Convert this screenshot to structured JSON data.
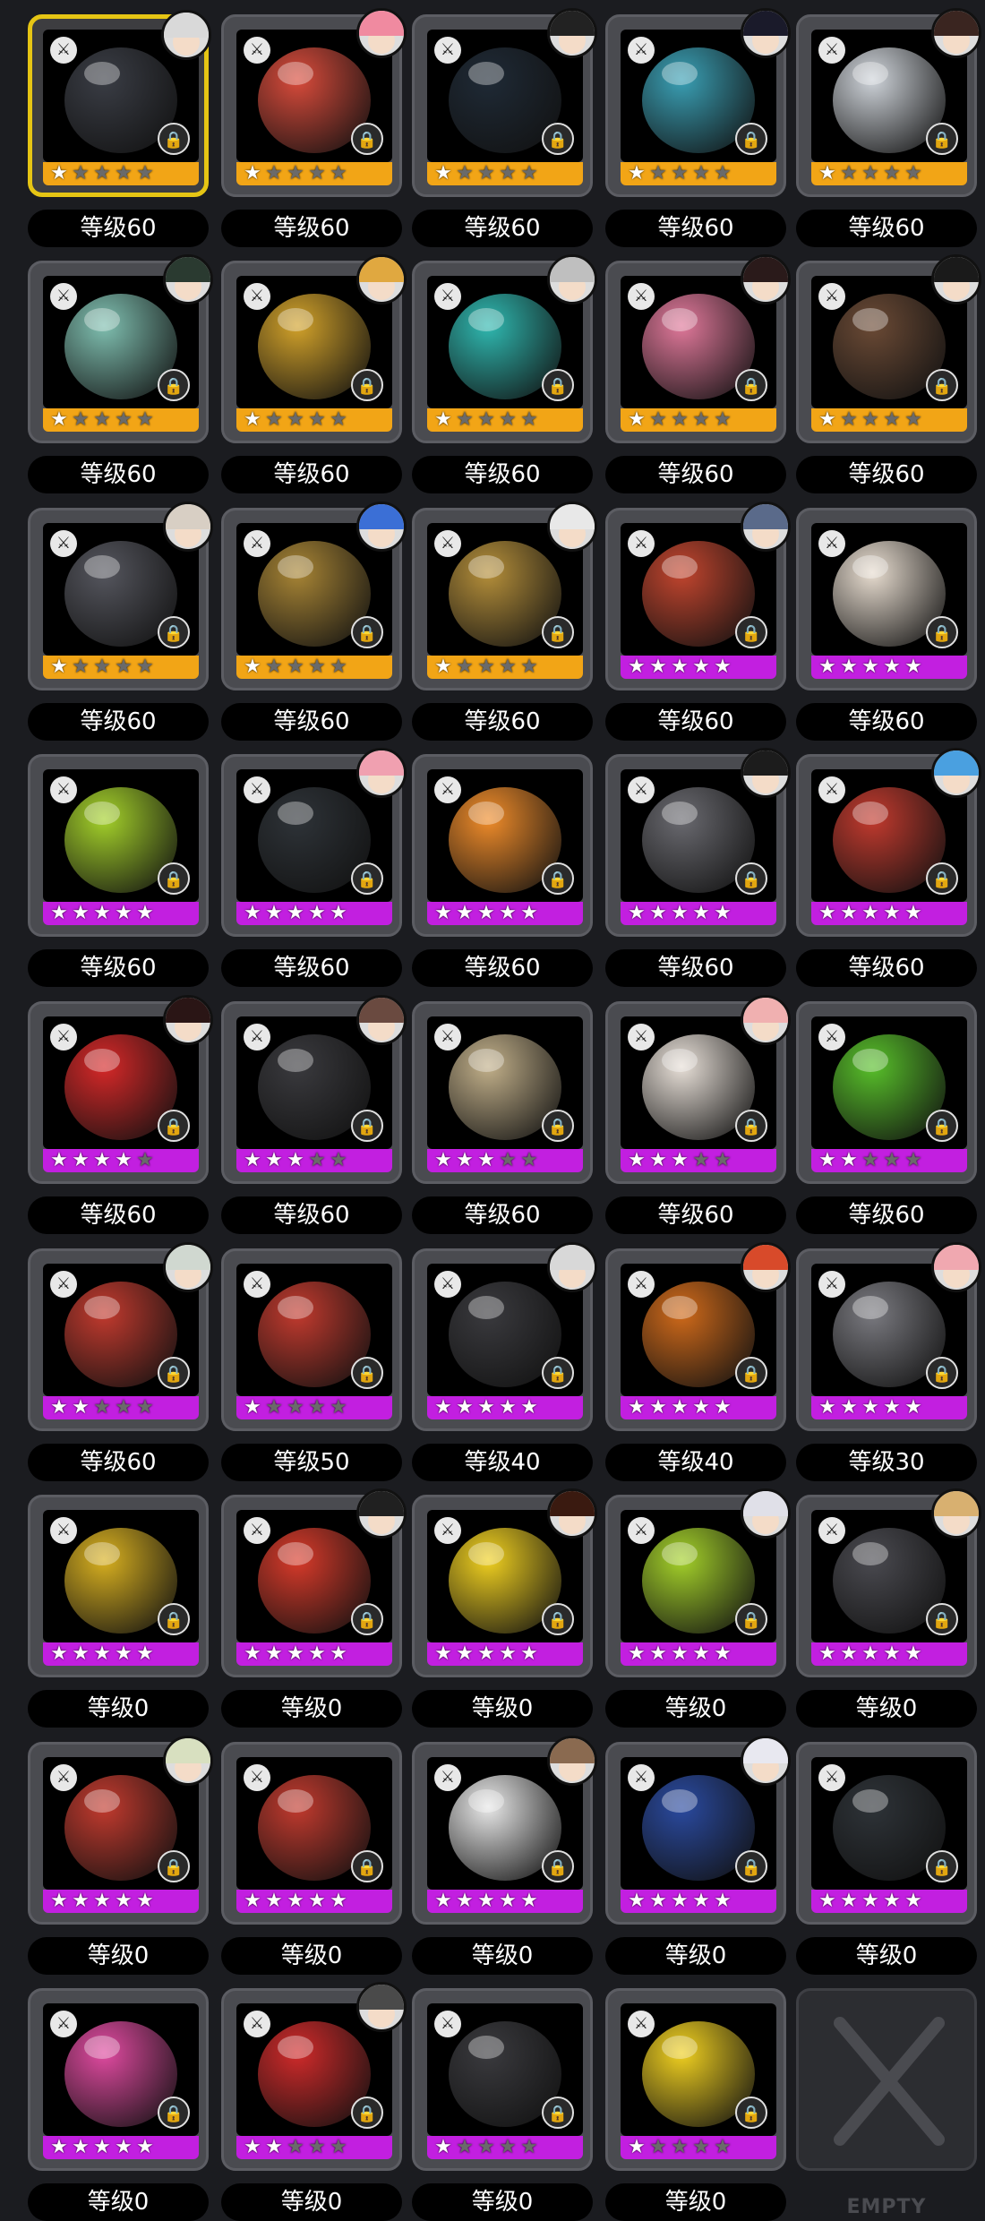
{
  "colors": {
    "gold_rarity": "#f2a516",
    "purple_rarity": "#c21fe0",
    "selected_border": "#e6c514",
    "level_pill": "#000000"
  },
  "cards": [
    {
      "level": "等级60",
      "rarity": "gold",
      "stars": 1,
      "selected": true,
      "avatar": true,
      "hair": "#d9d9d9",
      "orb": "#3a3d45"
    },
    {
      "level": "等级60",
      "rarity": "gold",
      "stars": 1,
      "avatar": true,
      "hair": "#f08aa0",
      "orb": "#d94b3b"
    },
    {
      "level": "等级60",
      "rarity": "gold",
      "stars": 1,
      "avatar": true,
      "hair": "#222222",
      "orb": "#1f2a36"
    },
    {
      "level": "等级60",
      "rarity": "gold",
      "stars": 1,
      "avatar": true,
      "hair": "#1a1a2a",
      "orb": "#3aa0b5"
    },
    {
      "level": "等级60",
      "rarity": "gold",
      "stars": 1,
      "avatar": true,
      "hair": "#3a2520",
      "orb": "#cfd4da"
    },
    {
      "level": "等级60",
      "rarity": "gold",
      "stars": 1,
      "avatar": true,
      "hair": "#2a3a30",
      "orb": "#7fbfb0"
    },
    {
      "level": "等级60",
      "rarity": "gold",
      "stars": 1,
      "avatar": true,
      "hair": "#e0a840",
      "orb": "#d2a22a"
    },
    {
      "level": "等级60",
      "rarity": "gold",
      "stars": 1,
      "avatar": true,
      "hair": "#bfbfbf",
      "orb": "#2fb8b0"
    },
    {
      "level": "等级60",
      "rarity": "gold",
      "stars": 1,
      "avatar": true,
      "hair": "#2a1a1a",
      "orb": "#e0789a"
    },
    {
      "level": "等级60",
      "rarity": "gold",
      "stars": 1,
      "avatar": true,
      "hair": "#1a1a1a",
      "orb": "#6b4a35"
    },
    {
      "level": "等级60",
      "rarity": "gold",
      "stars": 1,
      "avatar": true,
      "hair": "#d8cfc4",
      "orb": "#55565e"
    },
    {
      "level": "等级60",
      "rarity": "gold",
      "stars": 1,
      "avatar": true,
      "hair": "#3b6fd6",
      "orb": "#a88535"
    },
    {
      "level": "等级60",
      "rarity": "gold",
      "stars": 1,
      "avatar": true,
      "hair": "#e8e8e8",
      "orb": "#b58f3a"
    },
    {
      "level": "等级60",
      "rarity": "purple",
      "stars": 5,
      "avatar": true,
      "hair": "#5a6a8a",
      "orb": "#c2452e"
    },
    {
      "level": "等级60",
      "rarity": "purple",
      "stars": 5,
      "avatar": false,
      "orb": "#e8ddd0"
    },
    {
      "level": "等级60",
      "rarity": "purple",
      "stars": 5,
      "avatar": false,
      "orb": "#a4d12a"
    },
    {
      "level": "等级60",
      "rarity": "purple",
      "stars": 5,
      "avatar": true,
      "hair": "#f0a0b0",
      "orb": "#2e3338"
    },
    {
      "level": "等级60",
      "rarity": "purple",
      "stars": 5,
      "avatar": false,
      "orb": "#f08c2a"
    },
    {
      "level": "等级60",
      "rarity": "purple",
      "stars": 5,
      "avatar": true,
      "hair": "#1c1c1c",
      "orb": "#6a6a70"
    },
    {
      "level": "等级60",
      "rarity": "purple",
      "stars": 5,
      "avatar": true,
      "hair": "#4aa0e0",
      "orb": "#c23a2e"
    },
    {
      "level": "等级60",
      "rarity": "purple",
      "stars": 4,
      "avatar": true,
      "hair": "#2a1515",
      "orb": "#d62828"
    },
    {
      "level": "等级60",
      "rarity": "purple",
      "stars": 3,
      "avatar": true,
      "hair": "#6a4a40",
      "orb": "#3a3a3e"
    },
    {
      "level": "等级60",
      "rarity": "purple",
      "stars": 3,
      "avatar": false,
      "orb": "#c2b08a"
    },
    {
      "level": "等级60",
      "rarity": "purple",
      "stars": 3,
      "avatar": true,
      "hair": "#f0b0b0",
      "orb": "#e8e0d8"
    },
    {
      "level": "等级60",
      "rarity": "purple",
      "stars": 2,
      "avatar": false,
      "orb": "#58c02a"
    },
    {
      "level": "等级60",
      "rarity": "purple",
      "stars": 2,
      "avatar": true,
      "hair": "#d0d8d0",
      "orb": "#c23a2e"
    },
    {
      "level": "等级50",
      "rarity": "purple",
      "stars": 1,
      "avatar": false,
      "orb": "#c23a2e"
    },
    {
      "level": "等级40",
      "rarity": "purple",
      "stars": 5,
      "avatar": true,
      "hair": "#d8d8d8",
      "orb": "#3a3a3e"
    },
    {
      "level": "等级40",
      "rarity": "purple",
      "stars": 5,
      "avatar": true,
      "hair": "#d84a2a",
      "orb": "#d06a1a"
    },
    {
      "level": "等级30",
      "rarity": "purple",
      "stars": 5,
      "avatar": true,
      "hair": "#f0a8b0",
      "orb": "#7a7a80"
    },
    {
      "level": "等级0",
      "rarity": "purple",
      "stars": 5,
      "avatar": false,
      "orb": "#d8b020"
    },
    {
      "level": "等级0",
      "rarity": "purple",
      "stars": 5,
      "avatar": true,
      "hair": "#202020",
      "orb": "#d83a2a"
    },
    {
      "level": "等级0",
      "rarity": "purple",
      "stars": 5,
      "avatar": true,
      "hair": "#3a1a10",
      "orb": "#f0d020"
    },
    {
      "level": "等级0",
      "rarity": "purple",
      "stars": 5,
      "avatar": true,
      "hair": "#e0e0e8",
      "orb": "#a4d12a"
    },
    {
      "level": "等级0",
      "rarity": "purple",
      "stars": 5,
      "avatar": true,
      "hair": "#d8b070",
      "orb": "#4a4a50"
    },
    {
      "level": "等级0",
      "rarity": "purple",
      "stars": 5,
      "avatar": true,
      "hair": "#d8e0c0",
      "orb": "#c23a2e"
    },
    {
      "level": "等级0",
      "rarity": "purple",
      "stars": 5,
      "avatar": false,
      "orb": "#c23a2e"
    },
    {
      "level": "等级0",
      "rarity": "purple",
      "stars": 5,
      "avatar": true,
      "hair": "#8a6a50",
      "orb": "#e8e8e8"
    },
    {
      "level": "等级0",
      "rarity": "purple",
      "stars": 5,
      "avatar": true,
      "hair": "#e8e8f0",
      "orb": "#2a4aa0"
    },
    {
      "level": "等级0",
      "rarity": "purple",
      "stars": 5,
      "avatar": false,
      "orb": "#2e3338"
    },
    {
      "level": "等级0",
      "rarity": "purple",
      "stars": 5,
      "avatar": false,
      "orb": "#e04aa0"
    },
    {
      "level": "等级0",
      "rarity": "purple",
      "stars": 2,
      "avatar": true,
      "hair": "#4a4a4a",
      "orb": "#d02a2a"
    },
    {
      "level": "等级0",
      "rarity": "purple",
      "stars": 1,
      "avatar": false,
      "orb": "#3a3a3e"
    },
    {
      "level": "等级0",
      "rarity": "purple",
      "stars": 1,
      "avatar": false,
      "orb": "#f0d020"
    }
  ],
  "empty_slot": {
    "label": "EMPTY"
  }
}
